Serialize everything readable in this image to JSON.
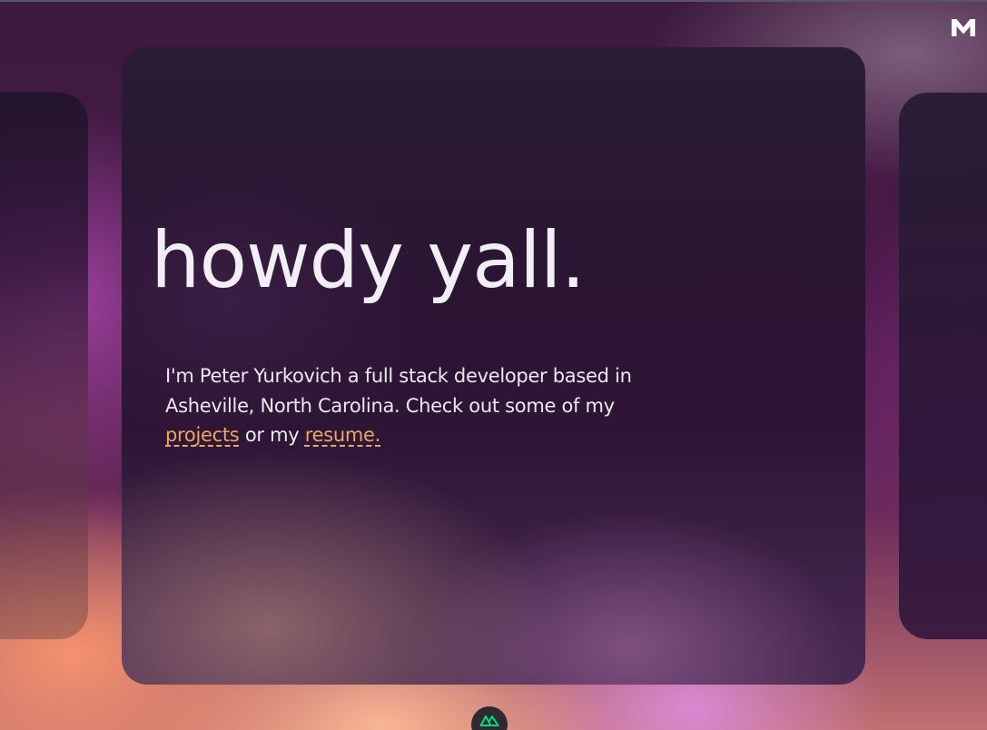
{
  "header": {
    "logo_icon": "m-logo-icon"
  },
  "hero": {
    "headline": "howdy yall.",
    "intro_text_1": "I'm Peter Yurkovich a full stack developer based in Asheville, North Carolina. Check out some of my ",
    "projects_link": "projects",
    "intro_text_2": " or my ",
    "resume_link": "resume."
  },
  "footer": {
    "badge_icon": "nuxt-icon"
  },
  "colors": {
    "link": "#e9a95e",
    "headline": "#f1eef6",
    "body_text": "#ece8f0",
    "nuxt_green": "#00dc82"
  }
}
